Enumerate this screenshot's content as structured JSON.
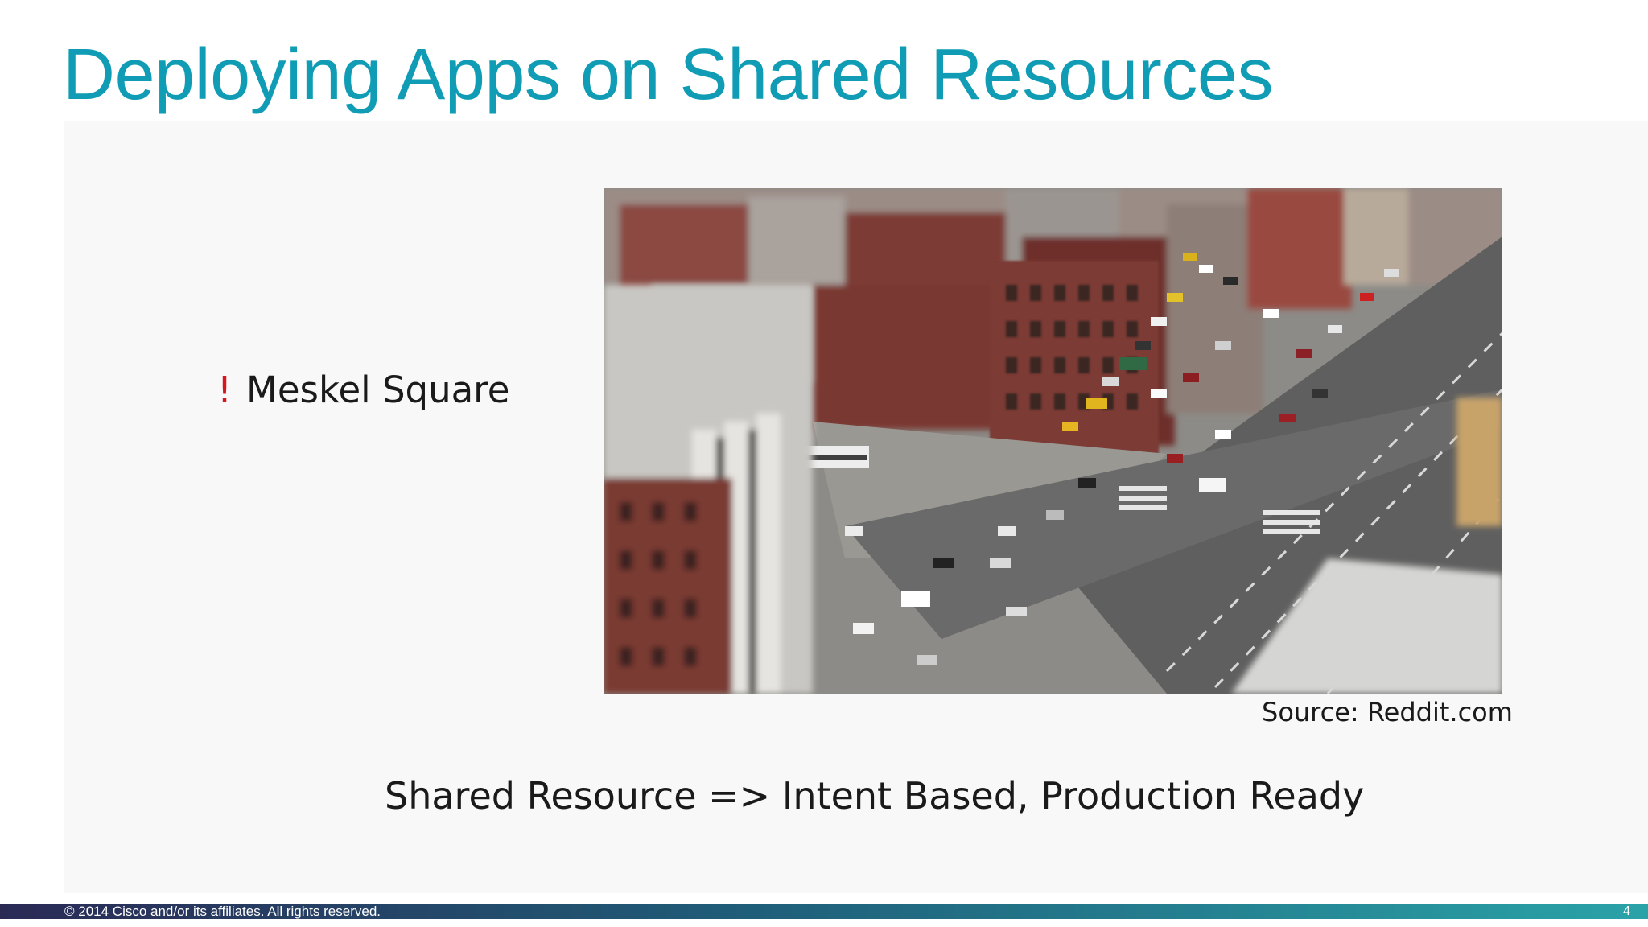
{
  "slide": {
    "title": "Deploying Apps on Shared Resources",
    "bullet": {
      "marker": "!",
      "text": "Meskel Square"
    },
    "image": {
      "description_icon": "city-intersection-photo"
    },
    "source": "Source: Reddit.com",
    "tagline": "Shared Resource => Intent Based, Production Ready",
    "footer": {
      "copyright": "© 2014  Cisco and/or its affiliates. All rights reserved.",
      "page_number": "4"
    }
  },
  "colors": {
    "title": "#109cb5",
    "bullet_marker": "#d6161c",
    "footer_start": "#2a2a55",
    "footer_end": "#2aa3a8"
  }
}
